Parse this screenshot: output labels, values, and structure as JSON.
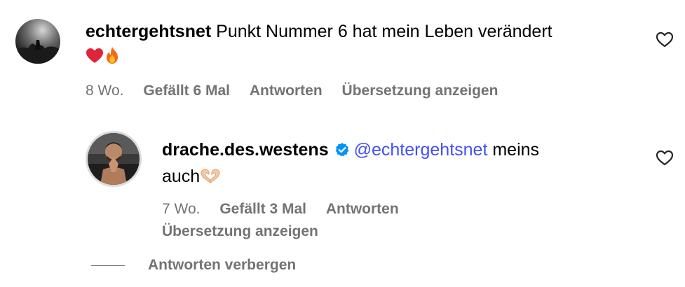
{
  "comment": {
    "username": "echtergehtsnet",
    "text": "Punkt Nummer 6 hat mein Leben verändert",
    "time": "8 Wo.",
    "likes": "Gefällt 6 Mal",
    "reply_label": "Antworten",
    "translate_label": "Übersetzung anzeigen",
    "emojis": [
      "heart-emoji",
      "fire-emoji"
    ]
  },
  "reply": {
    "username": "drache.des.westens",
    "mention": "@echtergehtsnet",
    "text_part1": "meins",
    "text_part2": "auch",
    "time": "7 Wo.",
    "likes": "Gefällt 3 Mal",
    "reply_label": "Antworten",
    "translate_label": "Übersetzung anzeigen",
    "emojis": [
      "heart-hands-emoji"
    ]
  },
  "hide_replies_label": "Antworten verbergen",
  "colors": {
    "meta": "#737373",
    "mention": "#4150f7",
    "verified": "#0095f6"
  }
}
